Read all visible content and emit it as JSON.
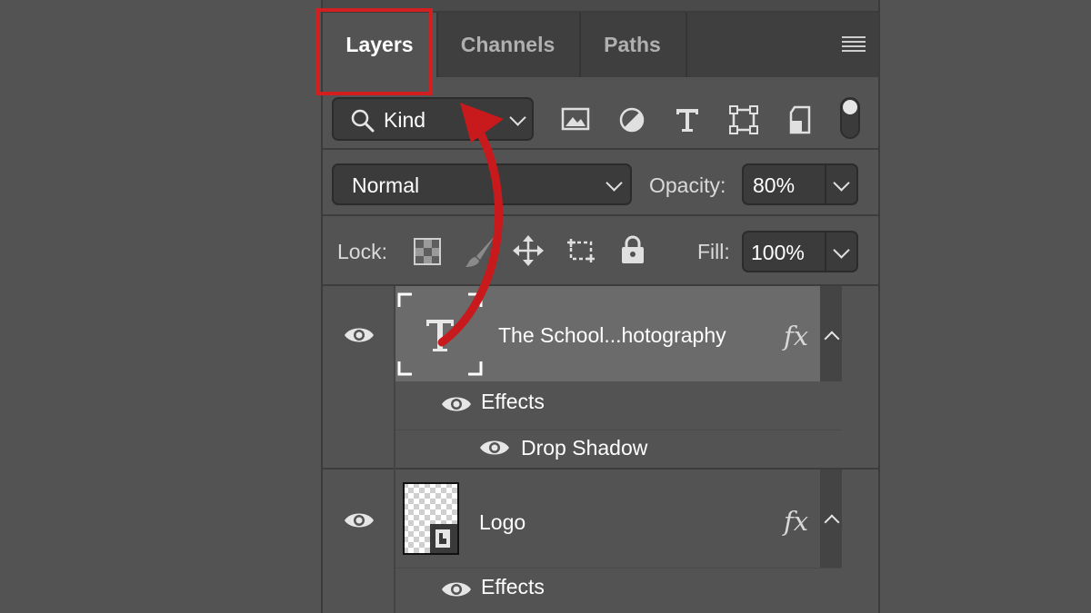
{
  "panel": {
    "tabs": [
      {
        "label": "Layers",
        "active": true
      },
      {
        "label": "Channels",
        "active": false
      },
      {
        "label": "Paths",
        "active": false
      }
    ],
    "menu_icon": "hamburger-menu-icon"
  },
  "filter": {
    "search_icon": "magnifier-icon",
    "kind_label": "Kind",
    "filter_icons": [
      "image-filter-icon",
      "adjustment-filter-icon",
      "type-filter-icon",
      "shape-filter-icon",
      "smart-object-filter-icon"
    ],
    "toggle_icon": "filter-toggle-icon"
  },
  "blend": {
    "mode": "Normal",
    "opacity_label": "Opacity:",
    "opacity_value": "80%"
  },
  "lock": {
    "label": "Lock:",
    "icons": [
      "lock-transparent-pixels-icon",
      "lock-image-pixels-icon",
      "lock-position-icon",
      "lock-artboard-icon",
      "lock-all-icon"
    ],
    "fill_label": "Fill:",
    "fill_value": "100%"
  },
  "layers": [
    {
      "name": "The School...hotography",
      "thumb": "type-layer-icon",
      "fx": "fx",
      "effects_label": "Effects",
      "effects": [
        "Drop Shadow"
      ]
    },
    {
      "name": "Logo",
      "thumb": "smart-object-thumbnail",
      "fx": "fx",
      "effects_label": "Effects"
    }
  ],
  "colors": {
    "background": "#535353",
    "highlight": "#d31f1f",
    "selected_layer": "#6b6b6b"
  }
}
